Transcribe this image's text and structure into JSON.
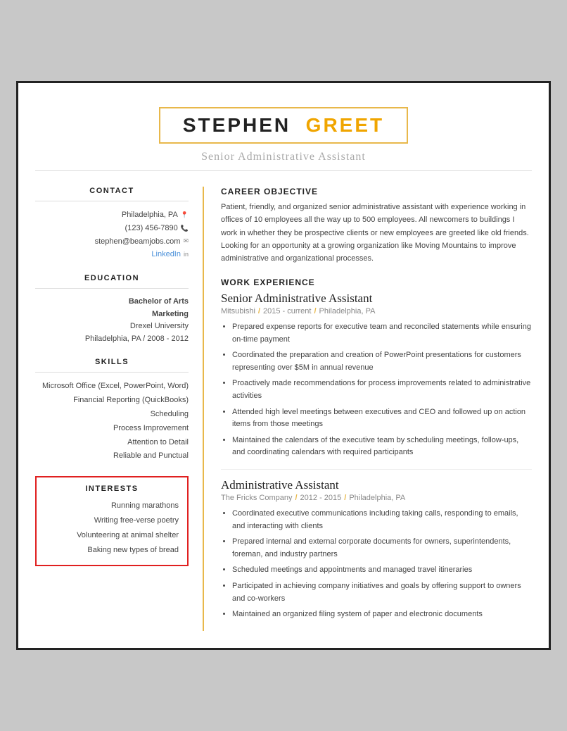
{
  "header": {
    "first_name": "STEPHEN",
    "last_name": "GREET",
    "subtitle": "Senior Administrative Assistant"
  },
  "left": {
    "contact": {
      "title": "CONTACT",
      "location": "Philadelphia, PA",
      "phone": "(123) 456-7890",
      "email": "stephen@beamjobs.com",
      "linkedin_label": "LinkedIn"
    },
    "education": {
      "title": "EDUCATION",
      "degree_line1": "Bachelor of Arts",
      "degree_line2": "Marketing",
      "university": "Drexel University",
      "location_year": "Philadelphia, PA  /  2008 - 2012"
    },
    "skills": {
      "title": "SKILLS",
      "items": [
        "Microsoft Office (Excel, PowerPoint, Word)",
        "Financial Reporting (QuickBooks)",
        "Scheduling",
        "Process Improvement",
        "Attention to Detail",
        "Reliable and Punctual"
      ]
    },
    "interests": {
      "title": "INTERESTS",
      "items": [
        "Running marathons",
        "Writing free-verse poetry",
        "Volunteering at animal shelter",
        "Baking new types of bread"
      ]
    }
  },
  "right": {
    "career_objective": {
      "title": "CAREER OBJECTIVE",
      "text": "Patient, friendly, and organized senior administrative assistant with experience working in offices of 10 employees all the way up to 500 employees. All newcomers to buildings I work in whether they be prospective clients or new employees are greeted like old friends. Looking for an opportunity at a growing organization like Moving Mountains to improve administrative and organizational processes."
    },
    "work_experience": {
      "title": "WORK EXPERIENCE",
      "jobs": [
        {
          "title": "Senior Administrative Assistant",
          "company": "Mitsubishi",
          "period": "2015 - current",
          "location": "Philadelphia, PA",
          "bullets": [
            "Prepared expense reports for executive team and reconciled statements while ensuring on-time payment",
            "Coordinated the preparation and creation of PowerPoint presentations for customers representing over $5M in annual revenue",
            "Proactively made recommendations for process improvements related to administrative activities",
            "Attended high level meetings between executives and CEO and followed up on action items from those meetings",
            "Maintained the calendars of the executive team by scheduling meetings, follow-ups, and coordinating calendars with required participants"
          ]
        },
        {
          "title": "Administrative Assistant",
          "company": "The Fricks Company",
          "period": "2012 - 2015",
          "location": "Philadelphia, PA",
          "bullets": [
            "Coordinated executive communications including taking calls, responding to emails, and interacting with clients",
            "Prepared internal and external corporate documents for owners, superintendents, foreman, and industry partners",
            "Scheduled meetings and appointments and managed travel itineraries",
            "Participated in achieving company initiatives and goals by offering support to owners and co-workers",
            "Maintained an organized filing system of paper and electronic documents"
          ]
        }
      ]
    }
  }
}
